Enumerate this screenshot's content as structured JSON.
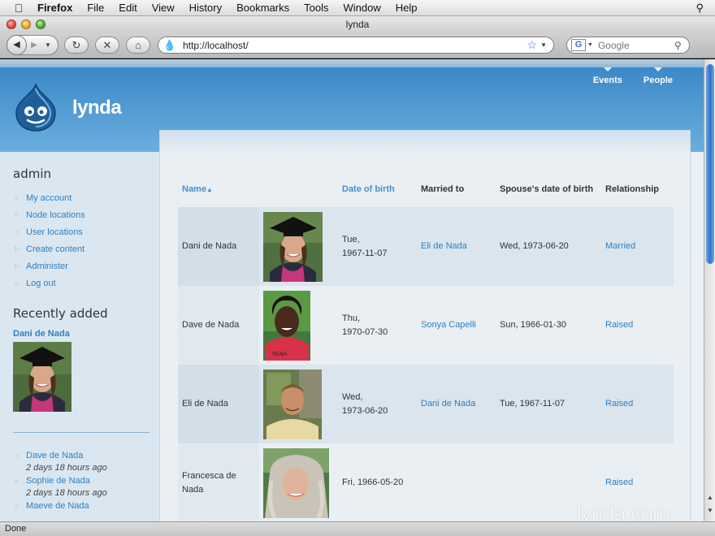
{
  "mac_menu": {
    "app": "Firefox",
    "items": [
      "File",
      "Edit",
      "View",
      "History",
      "Bookmarks",
      "Tools",
      "Window",
      "Help"
    ]
  },
  "window": {
    "title": "lynda"
  },
  "toolbar": {
    "url": "http://localhost/",
    "search_placeholder": "Google"
  },
  "site": {
    "name": "lynda",
    "nav": [
      "Events",
      "People"
    ]
  },
  "sidebar": {
    "user_title": "admin",
    "menu": [
      "My account",
      "Node locations",
      "User locations",
      "Create content",
      "Administer",
      "Log out"
    ],
    "recent_title": "Recently added",
    "recent_first": "Dani de Nada",
    "recent_list": [
      {
        "name": "Dave de Nada",
        "ago": "2 days 18 hours ago"
      },
      {
        "name": "Sophie de Nada",
        "ago": "2 days 18 hours ago"
      },
      {
        "name": "Maeve de Nada",
        "ago": ""
      }
    ]
  },
  "table": {
    "headers": {
      "name": "Name",
      "dob": "Date of birth",
      "married": "Married to",
      "spouse_dob": "Spouse's date of birth",
      "relationship": "Relationship"
    },
    "rows": [
      {
        "name": "Dani de Nada",
        "dob_day": "Tue,",
        "dob_date": "1967-11-07",
        "married": "Eli de Nada",
        "spouse_dob": "Wed, 1973-06-20",
        "relationship": "Married"
      },
      {
        "name": "Dave de Nada",
        "dob_day": "Thu,",
        "dob_date": "1970-07-30",
        "married": "Sonya Capelli",
        "spouse_dob": "Sun, 1966-01-30",
        "relationship": "Raised"
      },
      {
        "name": "Eli de Nada",
        "dob_day": "Wed,",
        "dob_date": "1973-06-20",
        "married": "Dani de Nada",
        "spouse_dob": "Tue, 1967-11-07",
        "relationship": "Raised"
      },
      {
        "name": "Francesca de Nada",
        "dob_day": "",
        "dob_date": "Fri, 1966-05-20",
        "married": "",
        "spouse_dob": "",
        "relationship": "Raised"
      }
    ]
  },
  "status": "Done",
  "watermark": "lynda.com"
}
